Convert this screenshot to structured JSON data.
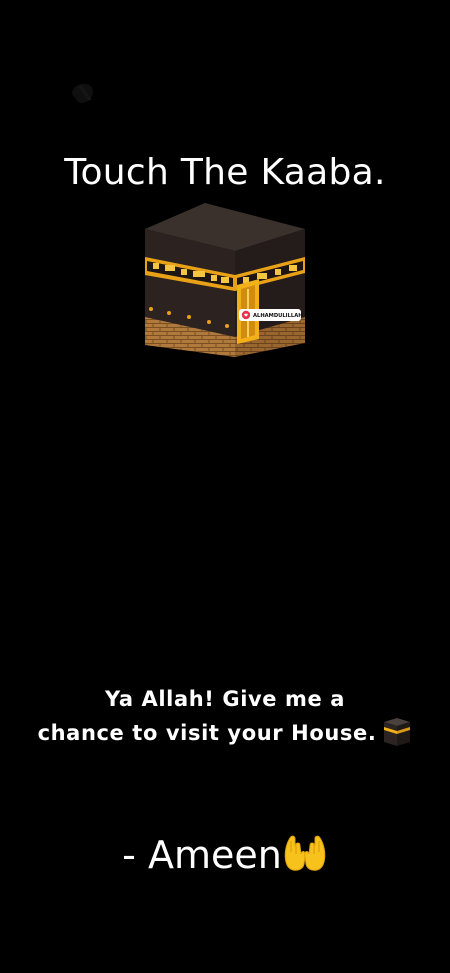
{
  "title": "Touch The Kaaba.",
  "kaaba_badge": {
    "text": "ALHAMDULILLAH",
    "icon": "heart-icon"
  },
  "dua": {
    "line1": "Ya Allah! Give me a",
    "line2": "chance to visit your House."
  },
  "closing": {
    "text": "- Ameen",
    "icon": "raised-hands-icon"
  },
  "colors": {
    "background": "#000000",
    "text": "#ffffff",
    "kaaba_black": "#2a2220",
    "gold": "#f2b019",
    "brick": "#a8743a"
  }
}
